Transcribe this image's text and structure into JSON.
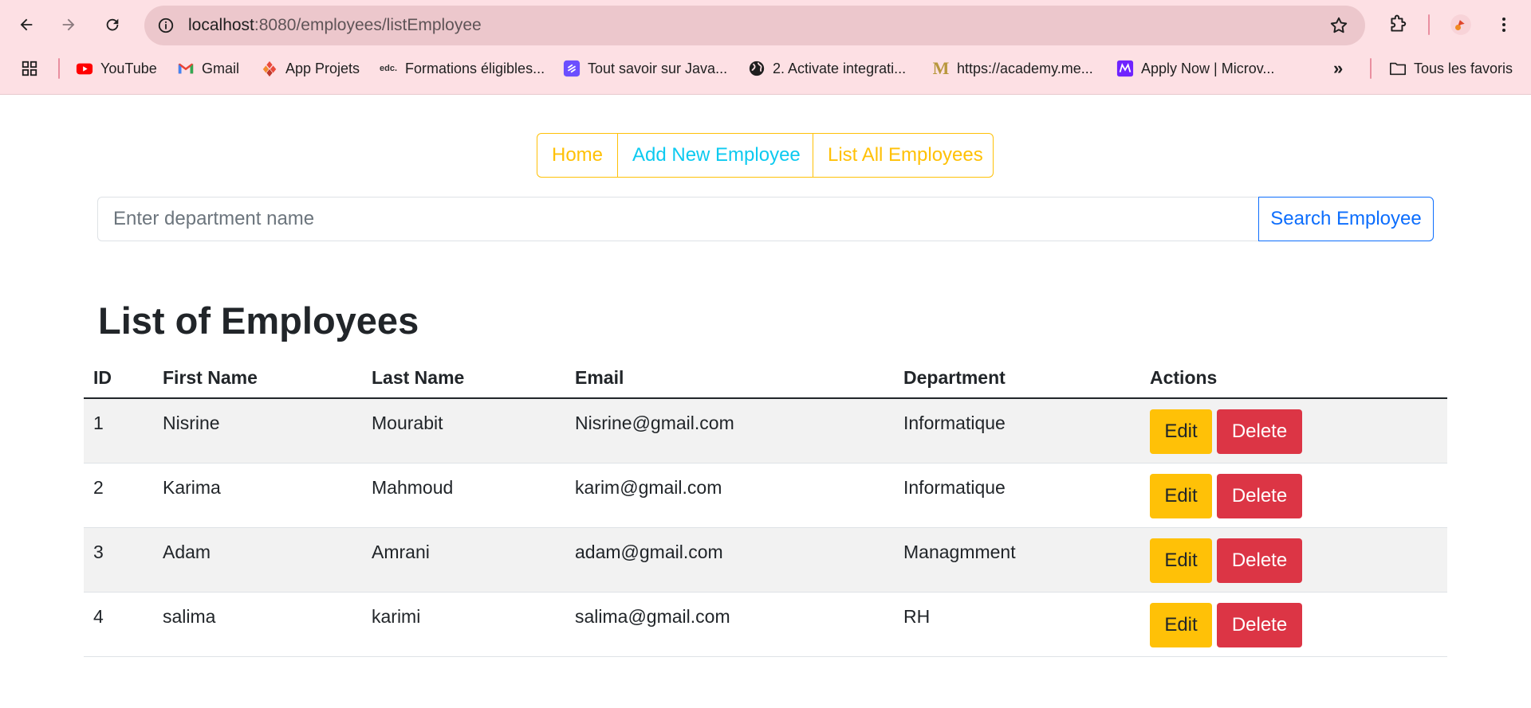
{
  "browser": {
    "url_host": "localhost",
    "url_path": ":8080/employees/listEmployee",
    "bookmarks": [
      {
        "label": "YouTube",
        "icon": "youtube-icon"
      },
      {
        "label": "Gmail",
        "icon": "gmail-icon"
      },
      {
        "label": "App Projets",
        "icon": "app-projets-icon"
      },
      {
        "label": "Formations éligibles...",
        "icon": "edc-icon"
      },
      {
        "label": "Tout savoir sur Java...",
        "icon": "java-guide-icon"
      },
      {
        "label": "2. Activate integrati...",
        "icon": "globe-icon"
      },
      {
        "label": "https://academy.me...",
        "icon": "academy-icon"
      },
      {
        "label": "Apply Now | Microv...",
        "icon": "microverse-icon"
      }
    ],
    "all_bookmarks": "Tous les favoris",
    "more_bookmarks": "»"
  },
  "nav": {
    "home": "Home",
    "add": "Add New Employee",
    "list": "List All Employees"
  },
  "search": {
    "placeholder": "Enter department name",
    "value": "",
    "button": "Search Employee"
  },
  "page": {
    "title": "List of Employees"
  },
  "table": {
    "headers": {
      "id": "ID",
      "first_name": "First Name",
      "last_name": "Last Name",
      "email": "Email",
      "department": "Department",
      "actions": "Actions"
    },
    "rows": [
      {
        "id": "1",
        "first_name": "Nisrine",
        "last_name": "Mourabit",
        "email": "Nisrine@gmail.com",
        "department": "Informatique"
      },
      {
        "id": "2",
        "first_name": "Karima",
        "last_name": "Mahmoud",
        "email": "karim@gmail.com",
        "department": "Informatique"
      },
      {
        "id": "3",
        "first_name": "Adam",
        "last_name": "Amrani",
        "email": "adam@gmail.com",
        "department": "Managmment"
      },
      {
        "id": "4",
        "first_name": "salima",
        "last_name": "karimi",
        "email": "salima@gmail.com",
        "department": "RH"
      }
    ],
    "edit_label": "Edit",
    "delete_label": "Delete"
  },
  "colors": {
    "chrome_bg": "#fde0e4",
    "warning": "#ffc107",
    "info": "#0dcaf0",
    "primary": "#0d6efd",
    "danger": "#dc3545"
  }
}
